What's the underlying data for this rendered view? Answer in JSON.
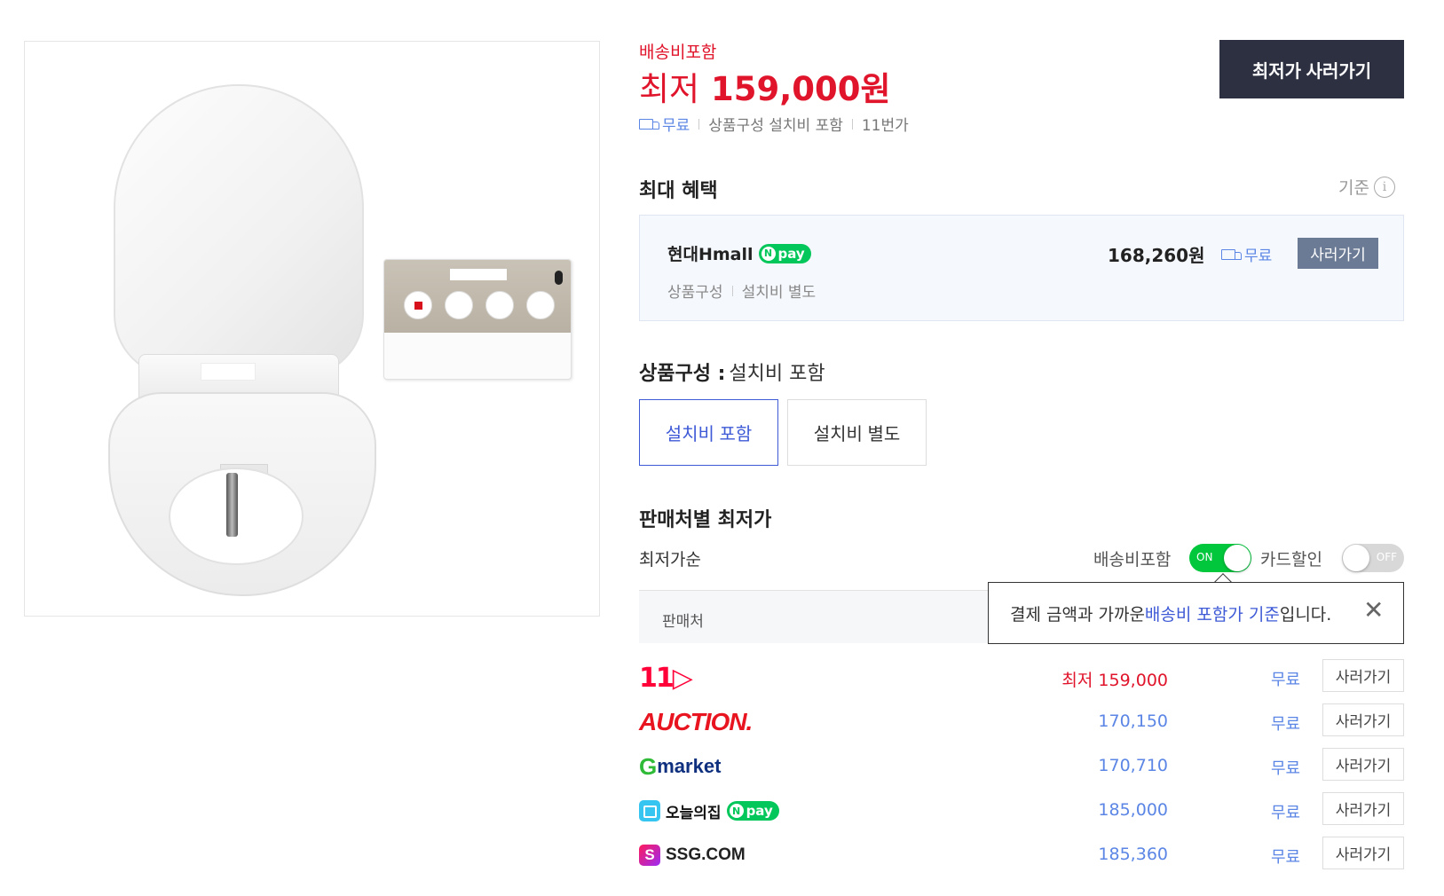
{
  "summary": {
    "shipping_included": "배송비포함",
    "lowest_prefix": "최저",
    "lowest_price": "159,000원",
    "shipping_free": "무료",
    "option": "상품구성 설치비 포함",
    "seller": "11번가",
    "buy_lowest_label": "최저가 사러가기"
  },
  "max_benefit": {
    "title": "최대 혜택",
    "basis": "기준",
    "mall": "현대Hmall",
    "npay": "pay",
    "sub_label": "상품구성",
    "sub_value": "설치비 별도",
    "price": "168,260원",
    "shipping": "무료",
    "buy_label": "사러가기"
  },
  "option": {
    "label": "상품구성 :",
    "value": "설치비 포함",
    "choices": [
      {
        "label": "설치비 포함",
        "selected": true
      },
      {
        "label": "설치비 별도",
        "selected": false
      }
    ]
  },
  "sellers_section": {
    "title": "판매처별 최저가",
    "sort": "최저가순",
    "toggle_shipping": {
      "label": "배송비포함",
      "state": "ON"
    },
    "toggle_card": {
      "label": "카드할인",
      "state": "OFF"
    },
    "table_header": "판매처",
    "tooltip": {
      "pre": "결제 금액과 가까운 ",
      "highlight": "배송비 포함가 기준",
      "post": "입니다."
    },
    "rows": [
      {
        "logo": "11번가",
        "price": "최저 159,000",
        "shipping": "무료",
        "buy": "사러가기"
      },
      {
        "logo": "AUCTION.",
        "price": "170,150",
        "shipping": "무료",
        "buy": "사러가기"
      },
      {
        "logo_g": "G",
        "logo_rest": "market",
        "price": "170,710",
        "shipping": "무료",
        "buy": "사러가기"
      },
      {
        "logo": "오늘의집",
        "npay": "pay",
        "price": "185,000",
        "shipping": "무료",
        "buy": "사러가기"
      },
      {
        "logo": "SSG.COM",
        "logo_icon": "S",
        "price": "185,360",
        "shipping": "무료",
        "buy": "사러가기"
      }
    ]
  },
  "colors": {
    "price_red": "#e0142b",
    "link_blue": "#5b86e5",
    "dark_button": "#2c3040",
    "toggle_on": "#00c73c"
  }
}
